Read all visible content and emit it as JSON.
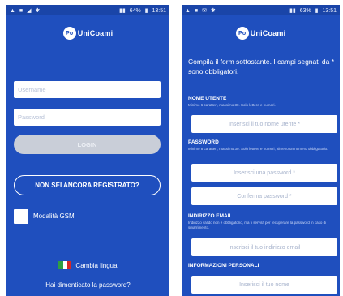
{
  "left_screen": {
    "status_time": "13:51",
    "battery": "64%",
    "logo_text": "UniCoami",
    "username_placeholder": "Username",
    "password_placeholder": "Password",
    "login_label": "LOGIN",
    "register_label": "NON SEI ANCORA REGISTRATO?",
    "gsm_label": "Modalità GSM",
    "language_label": "Cambia lingua",
    "forgot_label": "Hai dimenticato la password?",
    "flag_colors": [
      "#2f9e44",
      "#ffffff",
      "#d62828"
    ]
  },
  "right_screen": {
    "status_time": "13:51",
    "battery": "63%",
    "logo_text": "UniCoami",
    "intro": "Compila il form sottostante. I campi segnati da * sono obbligatori.",
    "sections": {
      "username": {
        "title": "NOME UTENTE",
        "note": "Minimo 6 caratteri, massimo 30. Solo lettere e numeri.",
        "placeholder": "Inserisci il tuo nome utente *"
      },
      "password": {
        "title": "PASSWORD",
        "note": "Minimo 8 caratteri, massimo 30. Solo lettere e numeri, almeno un numero obbligatorio.",
        "placeholder": "Inserisci una password *",
        "confirm_placeholder": "Conferma password *"
      },
      "email": {
        "title": "INDIRIZZO EMAIL",
        "note": "Indirizzo valido non è obbligatorio, ma ti servirà per recuperare la password in caso di smarrimento.",
        "placeholder": "Inserisci il tuo indirizzo email"
      },
      "personal": {
        "title": "INFORMAZIONI PERSONALI",
        "placeholder": "Inserisci il tuo nome"
      }
    }
  }
}
